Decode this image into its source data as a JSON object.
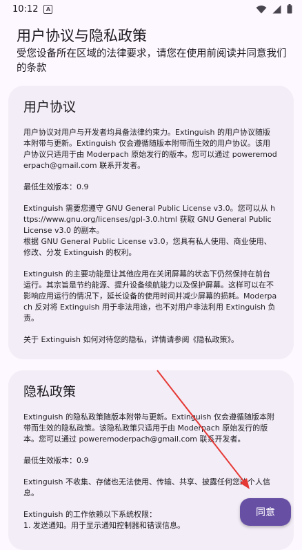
{
  "status_bar": {
    "time": "10:12",
    "notification": "A"
  },
  "header": {
    "title": "用户协议与隐私政策",
    "subtitle": "受您设备所在区域的法律要求，请您在使用前阅读并同意我们的条款"
  },
  "terms": {
    "title": "用户协议",
    "paragraphs": [
      "用户协议对用户与开发者均具备法律约束力。Extinguish 的用户协议随版本附带与更新。Extinguish 仅会遵循随版本附带而生效的用户协议。该用户协议只适用于由 Moderpach 原始发行的版本。您可以通过 poweremoderpach@gmail.com 联系开发者。",
      "最低生效版本：0.9",
      "Extinguish 需要您遵守 GNU General Public License v3.0。您可以从 https://www.gnu.org/licenses/gpl-3.0.html 获取 GNU General Public License v3.0 的副本。\n根据 GNU General Public License v3.0，您具有私人使用、商业使用、修改、分发 Extinguish 的权利。",
      "Extinguish 的主要功能是让其他应用在关闭屏幕的状态下仍然保持在前台运行。其宗旨是节约能源、提升设备续航能力以及保护屏幕。这样可以在不影响应用运行的情况下，延长设备的使用时间并减少屏幕的损耗。Moderpach 反对将 Extinguish 用于非法用途，也不对用户非法利用 Extinguish 负责。",
      "关于 Extinguish 如何对待您的隐私，详情请参阅《隐私政策》。"
    ]
  },
  "privacy": {
    "title": "隐私政策",
    "paragraphs": [
      "Extinguish 的隐私政策随版本附带与更新。Extinguish 仅会遵循随版本附带而生效的隐私政策。该隐私政策只适用于由 Moderpach 原始发行的版本。您可以通过 poweremoderpach@gmail.com 联系开发者。",
      "最低生效版本：0.9",
      "Extinguish 不收集、存储也无法使用、传输、共享、披露任何您的个人信息。",
      "Extinguish 的工作依赖以下系统权限：\n1. 发送通知。用于显示通知控制器和错误信息。"
    ]
  },
  "agree_button": {
    "label": "同意"
  },
  "colors": {
    "accent": "#6750a4",
    "card": "#f3edf7",
    "background": "#fdf7ff",
    "arrow": "#e53935"
  }
}
